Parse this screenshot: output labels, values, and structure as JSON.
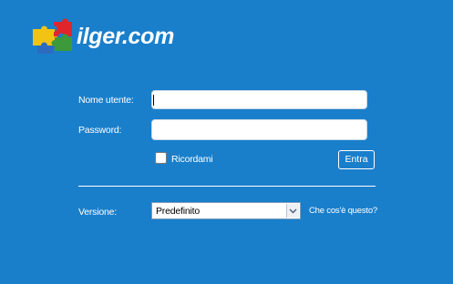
{
  "brand": {
    "name": "ilger.com",
    "logo_icon": "puzzle-pieces-icon",
    "logo_colors": [
      "#f2c314",
      "#e0262b",
      "#3c9a3a",
      "#2c6bc0"
    ]
  },
  "login": {
    "username_label": "Nome utente:",
    "username_value": "",
    "password_label": "Password:",
    "password_value": "",
    "remember_label": "Ricordami",
    "remember_checked": false,
    "submit_label": "Entra"
  },
  "version": {
    "label": "Versione:",
    "selected": "Predefinito",
    "help_link": "Che cos'è questo?",
    "dropdown_icon": "chevron-down-icon"
  },
  "colors": {
    "background": "#1a7fcb",
    "text": "#ffffff"
  }
}
